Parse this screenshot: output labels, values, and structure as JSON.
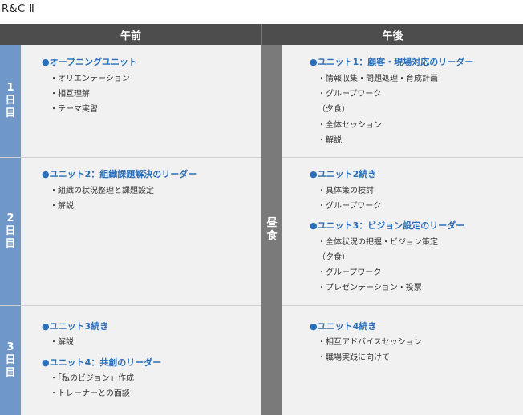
{
  "page_title": "R&C Ⅱ",
  "header": {
    "morning": "午前",
    "afternoon": "午後"
  },
  "lunch": [
    "昼",
    "食"
  ],
  "days": [
    {
      "label": [
        "1",
        "日",
        "目"
      ],
      "morning": [
        {
          "title": "●オープニングユニット",
          "items": [
            "・オリエンテーション",
            "・相互理解",
            "・テーマ実習"
          ]
        }
      ],
      "afternoon": [
        {
          "title": "●ユニット1：顧客・現場対応のリーダー",
          "items": [
            "・情報収集・問題処理・育成計画",
            "・グループワーク",
            "（夕食）",
            "・全体セッション",
            "・解説"
          ]
        }
      ]
    },
    {
      "label": [
        "2",
        "日",
        "目"
      ],
      "morning": [
        {
          "title": "●ユニット2：組織課題解決のリーダー",
          "items": [
            "・組織の状況整理と課題設定",
            "・解説"
          ]
        }
      ],
      "afternoon": [
        {
          "title": "●ユニット2続き",
          "items": [
            "・具体策の検討",
            "・グループワーク"
          ]
        },
        {
          "title": "●ユニット3：ビジョン設定のリーダー",
          "items": [
            "・全体状況の把握・ビジョン策定",
            "（夕食）",
            "・グループワーク",
            "・プレゼンテーション・投票"
          ]
        }
      ]
    },
    {
      "label": [
        "3",
        "日",
        "目"
      ],
      "morning": [
        {
          "title": "●ユニット3続き",
          "items": [
            "・解説"
          ]
        },
        {
          "title": "●ユニット4：共創のリーダー",
          "items": [
            "・「私のビジョン」作成",
            "・トレーナーとの面談"
          ]
        }
      ],
      "afternoon": [
        {
          "title": "●ユニット4続き",
          "items": [
            "・相互アドバイスセッション",
            "・職場実践に向けて"
          ]
        }
      ]
    }
  ],
  "colors": {
    "header_bg": "#4d4d4d",
    "day_bg": "#6f98c9",
    "lunch_bg": "#7a7a7a",
    "cell_bg": "#f1f1f1",
    "unit_text": "#2a6fba"
  }
}
